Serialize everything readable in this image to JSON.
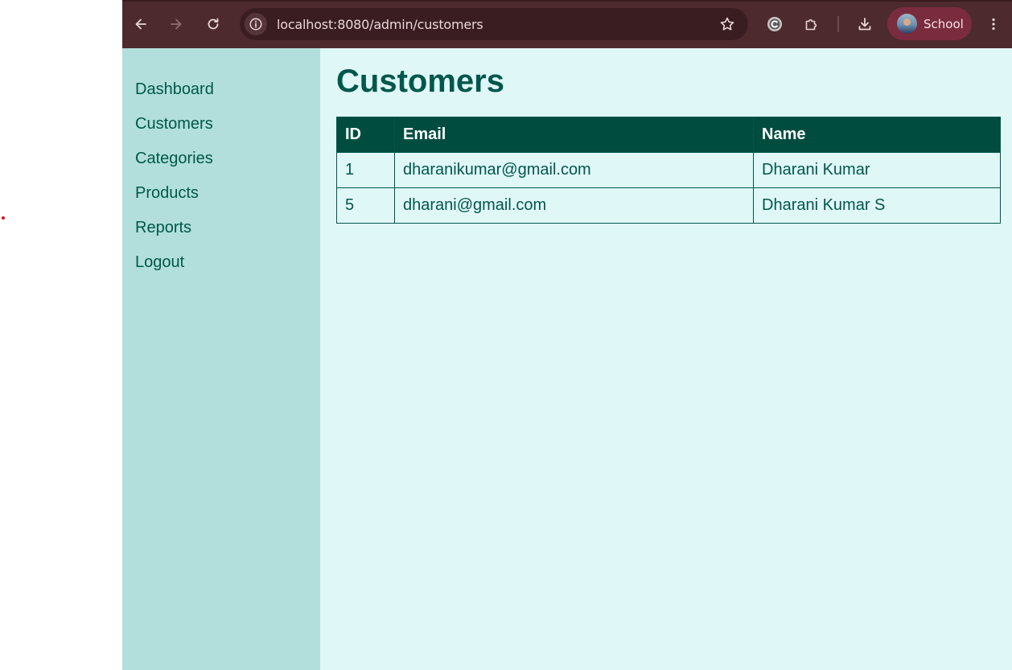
{
  "browser": {
    "url": "localhost:8080/admin/customers",
    "profile_name": "School",
    "icons": [
      "back-arrow-icon",
      "forward-arrow-icon",
      "reload-icon",
      "site-info-icon",
      "bookmark-star-icon",
      "extension-c-icon",
      "extensions-puzzle-icon",
      "download-icon",
      "kebab-menu-icon"
    ]
  },
  "sidebar": {
    "items": [
      {
        "label": "Dashboard"
      },
      {
        "label": "Customers"
      },
      {
        "label": "Categories"
      },
      {
        "label": "Products"
      },
      {
        "label": "Reports"
      },
      {
        "label": "Logout"
      }
    ]
  },
  "main": {
    "title": "Customers",
    "table": {
      "headers": [
        "ID",
        "Email",
        "Name"
      ],
      "rows": [
        [
          "1",
          "dharanikumar@gmail.com",
          "Dharani Kumar"
        ],
        [
          "5",
          "dharani@gmail.com",
          "Dharani Kumar S"
        ]
      ]
    }
  },
  "colors": {
    "toolbar": "#4d2a2e",
    "sidebar_bg": "#b2dfdb",
    "main_bg": "#e0f7f8",
    "accent": "#004d40",
    "text": "#00574b"
  }
}
